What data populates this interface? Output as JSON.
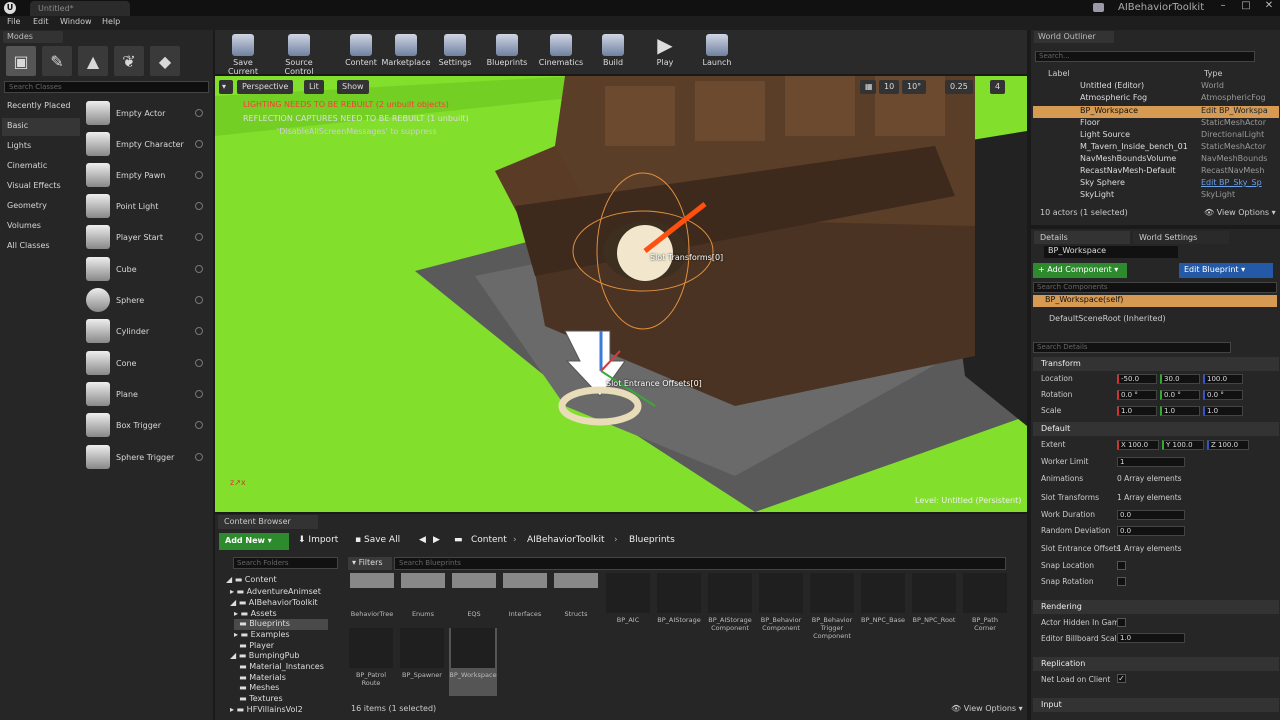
{
  "window": {
    "title": "Untitled*",
    "app_name": "AIBehaviorToolkit",
    "menu": [
      "File",
      "Edit",
      "Window",
      "Help"
    ]
  },
  "modes": {
    "tab_label": "Modes",
    "search_placeholder": "Search Classes",
    "categories": [
      "Recently Placed",
      "Basic",
      "Lights",
      "Cinematic",
      "Visual Effects",
      "Geometry",
      "Volumes",
      "All Classes"
    ],
    "selected_category": "Basic",
    "items": [
      "Empty Actor",
      "Empty Character",
      "Empty Pawn",
      "Point Light",
      "Player Start",
      "Cube",
      "Sphere",
      "Cylinder",
      "Cone",
      "Plane",
      "Box Trigger",
      "Sphere Trigger"
    ]
  },
  "toolbar": {
    "buttons": [
      "Save Current",
      "Source Control",
      "Content",
      "Marketplace",
      "Settings",
      "Blueprints",
      "Cinematics",
      "Build",
      "Play",
      "Launch"
    ]
  },
  "viewport": {
    "view_mode": "Perspective",
    "lighting": "Lit",
    "show": "Show",
    "warning_lighting": "LIGHTING NEEDS TO BE REBUILT (2 unbuilt objects)",
    "warning_reflection": "REFLECTION CAPTURES NEED TO BE REBUILT (1 unbuilt)",
    "warning_hint": "'DisableAllScreenMessages' to suppress",
    "snap_grid": "10",
    "snap_rot": "10°",
    "snap_scale": "0.25",
    "camera_speed": "4",
    "label_slot": "Slot Transforms[0]",
    "label_entrance": "Slot Entrance Offsets[0]",
    "level_label": "Level:  Untitled (Persistent)"
  },
  "content_browser": {
    "tab_label": "Content Browser",
    "add_new": "Add New",
    "import": "Import",
    "save_all": "Save All",
    "breadcrumb": [
      "Content",
      "AIBehaviorToolkit",
      "Blueprints"
    ],
    "folder_search_placeholder": "Search Folders",
    "filters_label": "Filters",
    "search_placeholder": "Search Blueprints",
    "tree": [
      {
        "label": "Content",
        "depth": 0
      },
      {
        "label": "AdventureAnimset",
        "depth": 1
      },
      {
        "label": "AIBehaviorToolkit",
        "depth": 1
      },
      {
        "label": "Assets",
        "depth": 2
      },
      {
        "label": "Blueprints",
        "depth": 2,
        "selected": true
      },
      {
        "label": "Examples",
        "depth": 2
      },
      {
        "label": "Player",
        "depth": 2
      },
      {
        "label": "BumpingPub",
        "depth": 1
      },
      {
        "label": "Material_Instances",
        "depth": 2
      },
      {
        "label": "Materials",
        "depth": 2
      },
      {
        "label": "Meshes",
        "depth": 2
      },
      {
        "label": "Textures",
        "depth": 2
      },
      {
        "label": "HFVillainsVol2",
        "depth": 1
      }
    ],
    "folders": [
      "BehaviorTree",
      "Enums",
      "EQS",
      "Interfaces",
      "Structs"
    ],
    "assets_row1": [
      "BP_AIC",
      "BP_AIStorage",
      "BP_AIStorage Component",
      "BP_Behavior Component",
      "BP_Behavior Trigger Component",
      "BP_NPC_Base",
      "BP_NPC_Root",
      "BP_Path Corner"
    ],
    "assets_row2": [
      "BP_Patrol Route",
      "BP_Spawner",
      "BP_Workspace"
    ],
    "selected_asset": "BP_Workspace",
    "items_count": "16 items (1 selected)",
    "view_options": "View Options"
  },
  "outliner": {
    "tab_label": "World Outliner",
    "search_placeholder": "Search...",
    "col_label": "Label",
    "col_type": "Type",
    "rows": [
      {
        "label": "Untitled (Editor)",
        "type": "World"
      },
      {
        "label": "Atmospheric Fog",
        "type": "AtmosphericFog"
      },
      {
        "label": "BP_Workspace",
        "type": "Edit BP_Workspa",
        "selected": true
      },
      {
        "label": "Floor",
        "type": "StaticMeshActor"
      },
      {
        "label": "Light Source",
        "type": "DirectionalLight"
      },
      {
        "label": "M_Tavern_Inside_bench_01",
        "type": "StaticMeshActor"
      },
      {
        "label": "NavMeshBoundsVolume",
        "type": "NavMeshBounds"
      },
      {
        "label": "RecastNavMesh-Default",
        "type": "RecastNavMesh"
      },
      {
        "label": "Sky Sphere",
        "type": "Edit BP_Sky_Sp"
      },
      {
        "label": "SkyLight",
        "type": "SkyLight"
      }
    ],
    "count": "10 actors (1 selected)",
    "view_options": "View Options"
  },
  "details": {
    "tab_details": "Details",
    "tab_world": "World Settings",
    "actor_name": "BP_Workspace",
    "add_component": "+ Add Component",
    "edit_blueprint": "Edit Blueprint",
    "comp_search_placeholder": "Search Components",
    "comp_self": "BP_Workspace(self)",
    "comp_root": "DefaultSceneRoot (Inherited)",
    "details_search_placeholder": "Search Details",
    "section_transform": "Transform",
    "location_label": "Location",
    "location": [
      "-50.0",
      "30.0",
      "100.0"
    ],
    "rotation_label": "Rotation",
    "rotation": [
      "0.0 °",
      "0.0 °",
      "0.0 °"
    ],
    "scale_label": "Scale",
    "scale": [
      "1.0",
      "1.0",
      "1.0"
    ],
    "section_default": "Default",
    "extent_label": "Extent",
    "extent": [
      "X 100.0",
      "Y 100.0",
      "Z 100.0"
    ],
    "worker_limit_label": "Worker Limit",
    "worker_limit": "1",
    "animations_label": "Animations",
    "animations": "0 Array elements",
    "slot_transforms_label": "Slot Transforms",
    "slot_transforms": "1 Array elements",
    "work_duration_label": "Work Duration",
    "work_duration": "0.0",
    "random_deviation_label": "Random Deviation",
    "random_deviation": "0.0",
    "slot_entrance_label": "Slot Entrance Offsets",
    "slot_entrance": "1 Array elements",
    "snap_location_label": "Snap Location",
    "snap_rotation_label": "Snap Rotation",
    "section_rendering": "Rendering",
    "actor_hidden_label": "Actor Hidden In Game",
    "billboard_label": "Editor Billboard Scale",
    "billboard": "1.0",
    "section_replication": "Replication",
    "net_load_label": "Net Load on Client",
    "section_input": "Input"
  }
}
